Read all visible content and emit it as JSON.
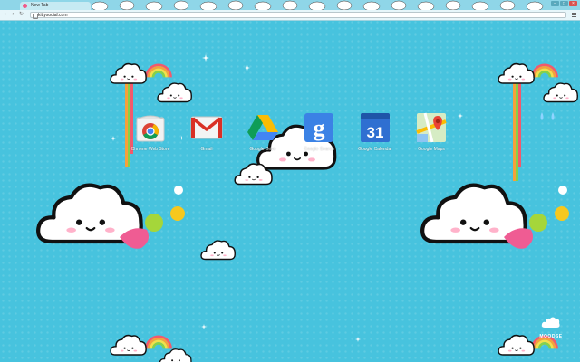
{
  "browser": {
    "tab_title": "New Tab",
    "address": "kittysocial.com",
    "window_controls": [
      "minimize-icon",
      "maximize-icon",
      "close-icon"
    ]
  },
  "apps": [
    {
      "label": "Chrome Web Store",
      "icon": "chrome-web-store-icon"
    },
    {
      "label": "Gmail",
      "icon": "gmail-icon"
    },
    {
      "label": "Google Drive",
      "icon": "google-drive-icon"
    },
    {
      "label": "Google Search",
      "icon": "google-search-icon"
    },
    {
      "label": "Google Calendar",
      "icon": "google-calendar-icon",
      "badge": "31"
    },
    {
      "label": "Google Maps",
      "icon": "google-maps-icon"
    }
  ],
  "brand": {
    "text": "MOODSE"
  },
  "theme": {
    "background": "#47c3de",
    "cloud": "#ffffff",
    "outline": "#111111",
    "blush": "#ff7ba3",
    "balloon_green": "#a5d63a",
    "balloon_yellow": "#f6c81e",
    "balloon_pink": "#ef5c93"
  }
}
